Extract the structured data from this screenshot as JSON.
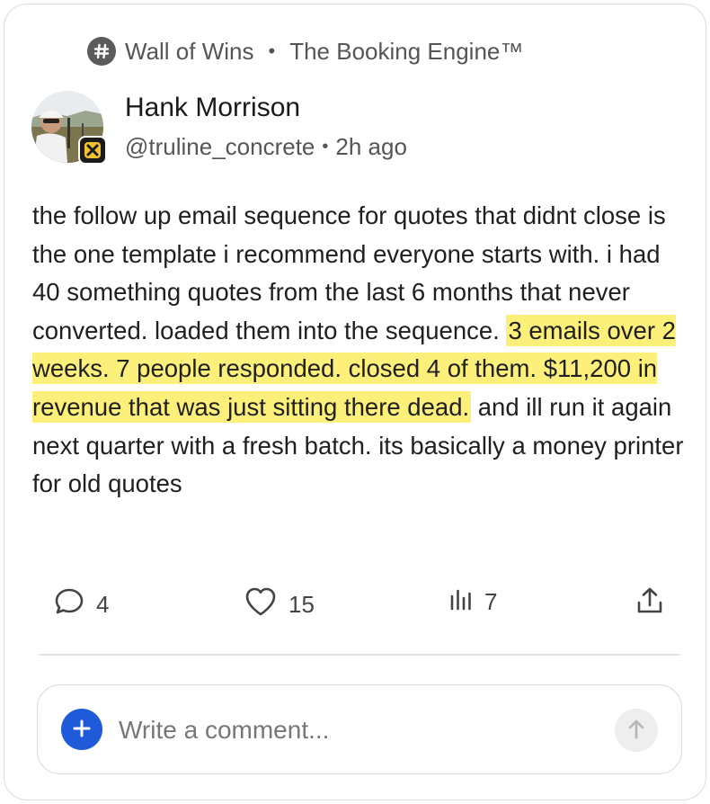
{
  "breadcrumb": {
    "icon": "hash-icon",
    "community": "Wall of Wins",
    "separator": "•",
    "space": "The Booking Engine™"
  },
  "author": {
    "name": "Hank Morrison",
    "handle": "@truline_concrete",
    "separator": "•",
    "time": "2h ago",
    "badge_icon": "x-badge-icon"
  },
  "post": {
    "text_before": "the follow up email sequence for quotes that didnt close is the one template i recommend everyone starts with. i had 40 something quotes from the last 6 months that never converted. loaded them into the sequence. ",
    "highlight": "3 emails over 2 weeks. 7 people responded. closed 4 of them. $11,200 in revenue that was just sitting there dead.",
    "text_after": " and ill run it again next quarter with a fresh batch. its basically a money printer for old quotes",
    "highlight_color": "#fdf07a"
  },
  "actions": {
    "comments": {
      "icon": "comment-icon",
      "count": "4"
    },
    "likes": {
      "icon": "heart-icon",
      "count": "15"
    },
    "views": {
      "icon": "views-icon",
      "count": "7"
    },
    "share": {
      "icon": "share-icon"
    }
  },
  "composer": {
    "placeholder": "Write a comment...",
    "add_icon": "plus-icon",
    "send_icon": "arrow-up-icon",
    "accent": "#1f5bd8"
  }
}
